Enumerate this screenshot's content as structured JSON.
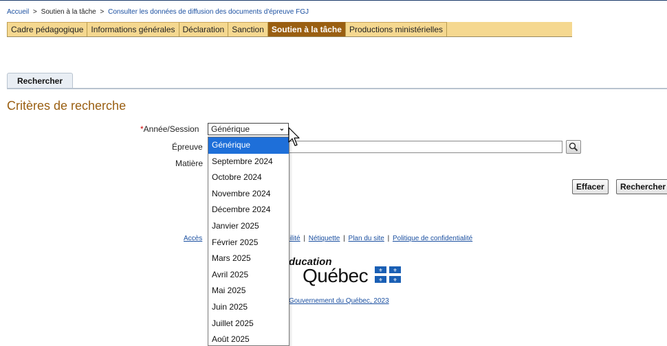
{
  "breadcrumb": {
    "home": "Accueil",
    "sep1": ">",
    "current_section": "Soutien à la tâche",
    "sep2": ">",
    "page": "Consulter les données de diffusion des documents d'épreuve FGJ"
  },
  "nav": {
    "tabs": [
      "Cadre pédagogique",
      "Informations générales",
      "Déclaration",
      "Sanction",
      "Soutien à la tâche",
      "Productions ministérielles"
    ],
    "active_index": 4
  },
  "search_tab_label": "Rechercher",
  "section_title": "Critères de recherche",
  "form": {
    "required_mark": "*",
    "annee_label": "Année/Session",
    "annee_value": "Générique",
    "epreuve_label": "Épreuve",
    "epreuve_value": "",
    "matiere_label": "Matière",
    "effacer_label": "Effacer",
    "rechercher_label": "Rechercher"
  },
  "dropdown_options": [
    "Générique",
    "Septembre 2024",
    "Octobre 2024",
    "Novembre 2024",
    "Décembre 2024",
    "Janvier 2025",
    "Février 2025",
    "Mars 2025",
    "Avril 2025",
    "Mai 2025",
    "Juin 2025",
    "Juillet 2025",
    "Août 2025"
  ],
  "dropdown_selected_index": 0,
  "footer": {
    "links_visible": [
      "Accès",
      "ibilité",
      "Nétiquette",
      "Plan du site",
      "Politique de confidentialité"
    ],
    "logo_line1": "ducation",
    "logo_line2": "Québec",
    "copyright": "Gouvernement du Québec, 2023"
  },
  "colors": {
    "nav_bg": "#f5d890",
    "nav_active": "#9a5f12",
    "title": "#9a5f12",
    "link": "#1a4fa0",
    "dropdown_highlight": "#1e6fd9",
    "flag_blue": "#1a5fb4"
  }
}
